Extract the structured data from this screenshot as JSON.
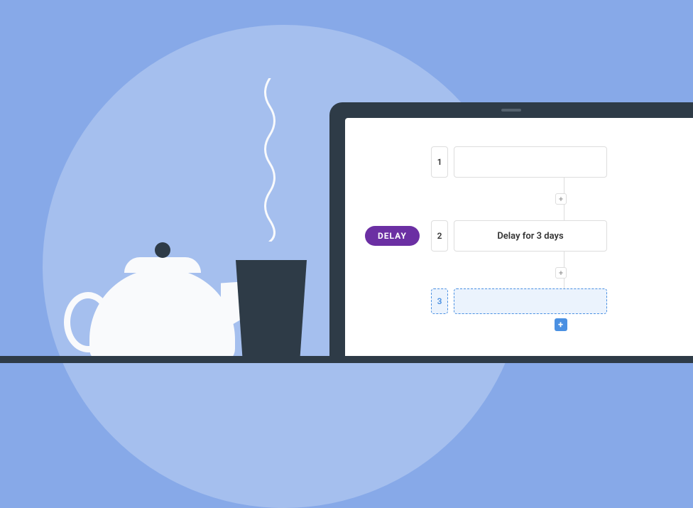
{
  "workflow": {
    "steps": [
      {
        "number": "1",
        "label": ""
      },
      {
        "number": "2",
        "label": "Delay for 3 days"
      },
      {
        "number": "3",
        "label": ""
      }
    ],
    "badge_label": "DELAY",
    "add_symbol": "+"
  }
}
